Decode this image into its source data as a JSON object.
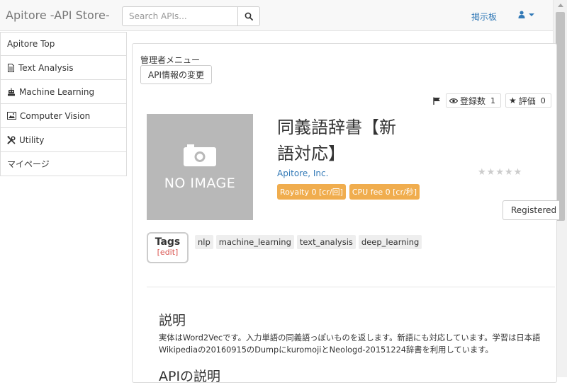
{
  "navbar": {
    "brand": "Apitore -API Store-",
    "search_placeholder": "Search APIs...",
    "board_link": "掲示板",
    "search_icon": "search-icon",
    "user_icon": "user-icon"
  },
  "sidebar": {
    "items": [
      {
        "label": "Apitore Top",
        "icon": ""
      },
      {
        "label": "Text Analysis",
        "icon": "document-icon"
      },
      {
        "label": "Machine Learning",
        "icon": "robot-icon"
      },
      {
        "label": "Computer Vision",
        "icon": "picture-icon"
      },
      {
        "label": "Utility",
        "icon": "tools-icon"
      },
      {
        "label": "マイページ",
        "icon": ""
      }
    ]
  },
  "admin": {
    "label": "管理者メニュー",
    "button": "API情報の変更"
  },
  "stats": {
    "registered_label": "登録数",
    "registered_count": "1",
    "rating_label": "評価",
    "rating_count": "0"
  },
  "api": {
    "image_placeholder": "NO IMAGE",
    "title": "同義語辞書【新語対応】",
    "author": "Apitore, Inc.",
    "royalty": "Royalty 0 [cr/回]",
    "cpu_fee": "CPU fee 0 [cr/秒]",
    "stars": 0,
    "stars_max": 5,
    "registered_button": "Registered"
  },
  "tags": {
    "title": "Tags",
    "edit": "[edit]",
    "items": [
      "nlp",
      "machine_learning",
      "text_analysis",
      "deep_learning"
    ]
  },
  "description": {
    "title": "説明",
    "body": "実体はWord2Vecです。入力単語の同義語っぽいものを返します。新語にも対応しています。学習は日本語Wikipediaの20160915のDumpにkuromojiとNeologd-20151224辞書を利用しています。",
    "next_title": "APIの説明"
  },
  "colors": {
    "link": "#337ab7",
    "warning_label": "#f0ad4e",
    "edit": "#d9534f",
    "noimage_bg": "#b8b8b8"
  }
}
